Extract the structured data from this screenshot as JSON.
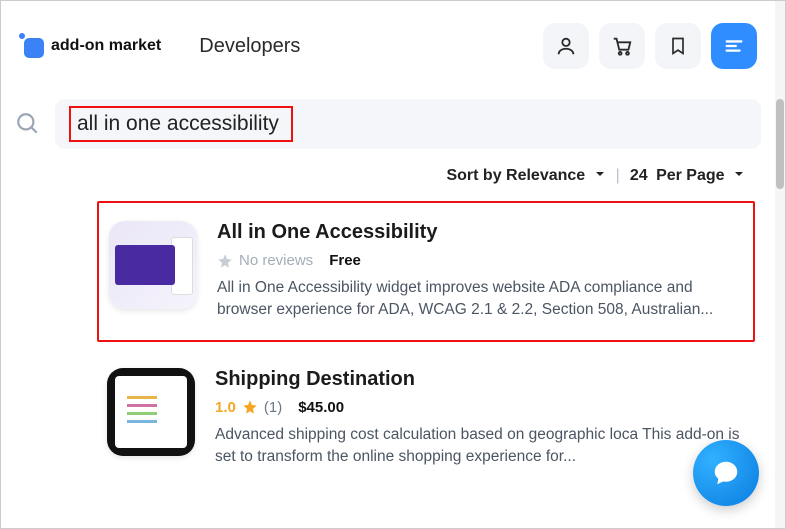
{
  "header": {
    "brand": "add-on market",
    "developers_link": "Developers"
  },
  "search": {
    "value": "all in one accessibility"
  },
  "sort": {
    "label": "Sort by Relevance",
    "per_page_count": "24",
    "per_page_label": "Per Page"
  },
  "results": [
    {
      "title": "All in One Accessibility",
      "reviews_label": "No reviews",
      "price": "Free",
      "description": "All in One Accessibility widget improves website ADA compliance and browser experience for ADA, WCAG 2.1 & 2.2, Section 508, Australian..."
    },
    {
      "title": "Shipping Destination",
      "rating": "1.0",
      "review_count": "(1)",
      "price": "$45.00",
      "description": "Advanced shipping cost calculation based on geographic loca       This add-on is set to transform the online shopping experience for..."
    }
  ]
}
